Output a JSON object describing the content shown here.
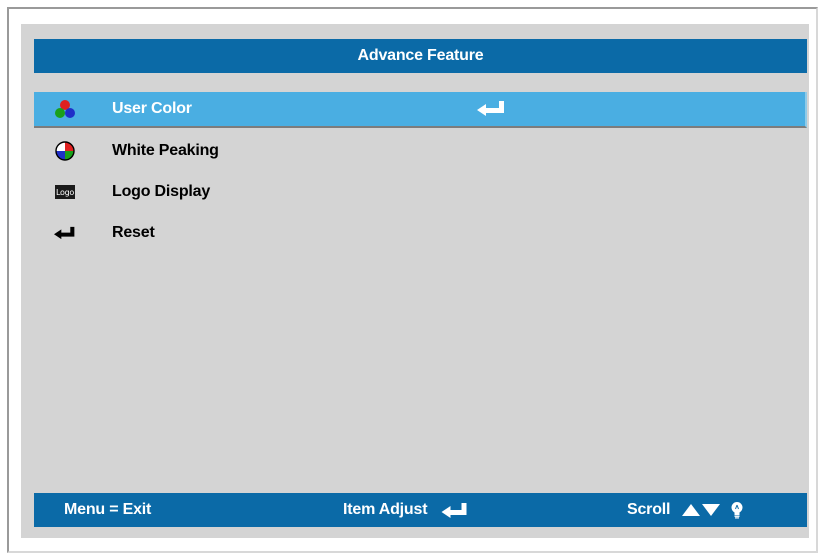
{
  "title": "Advance Feature",
  "menu": {
    "items": [
      {
        "label": "User Color",
        "icon": "rgb-dots-icon",
        "selected": true,
        "has_enter": true
      },
      {
        "label": "White Peaking",
        "icon": "color-wheel-icon",
        "selected": false,
        "has_enter": false
      },
      {
        "label": "Logo Display",
        "icon": "logo-icon",
        "icon_text": "Logo",
        "selected": false,
        "has_enter": false
      },
      {
        "label": "Reset",
        "icon": "enter-arrow-icon",
        "selected": false,
        "has_enter": false
      }
    ]
  },
  "footer": {
    "exit_label": "Menu = Exit",
    "adjust_label": "Item Adjust",
    "scroll_label": "Scroll"
  },
  "colors": {
    "bar_blue": "#0b6aa7",
    "selected_row": "#4aaee2",
    "panel_gray": "#d4d4d4"
  }
}
